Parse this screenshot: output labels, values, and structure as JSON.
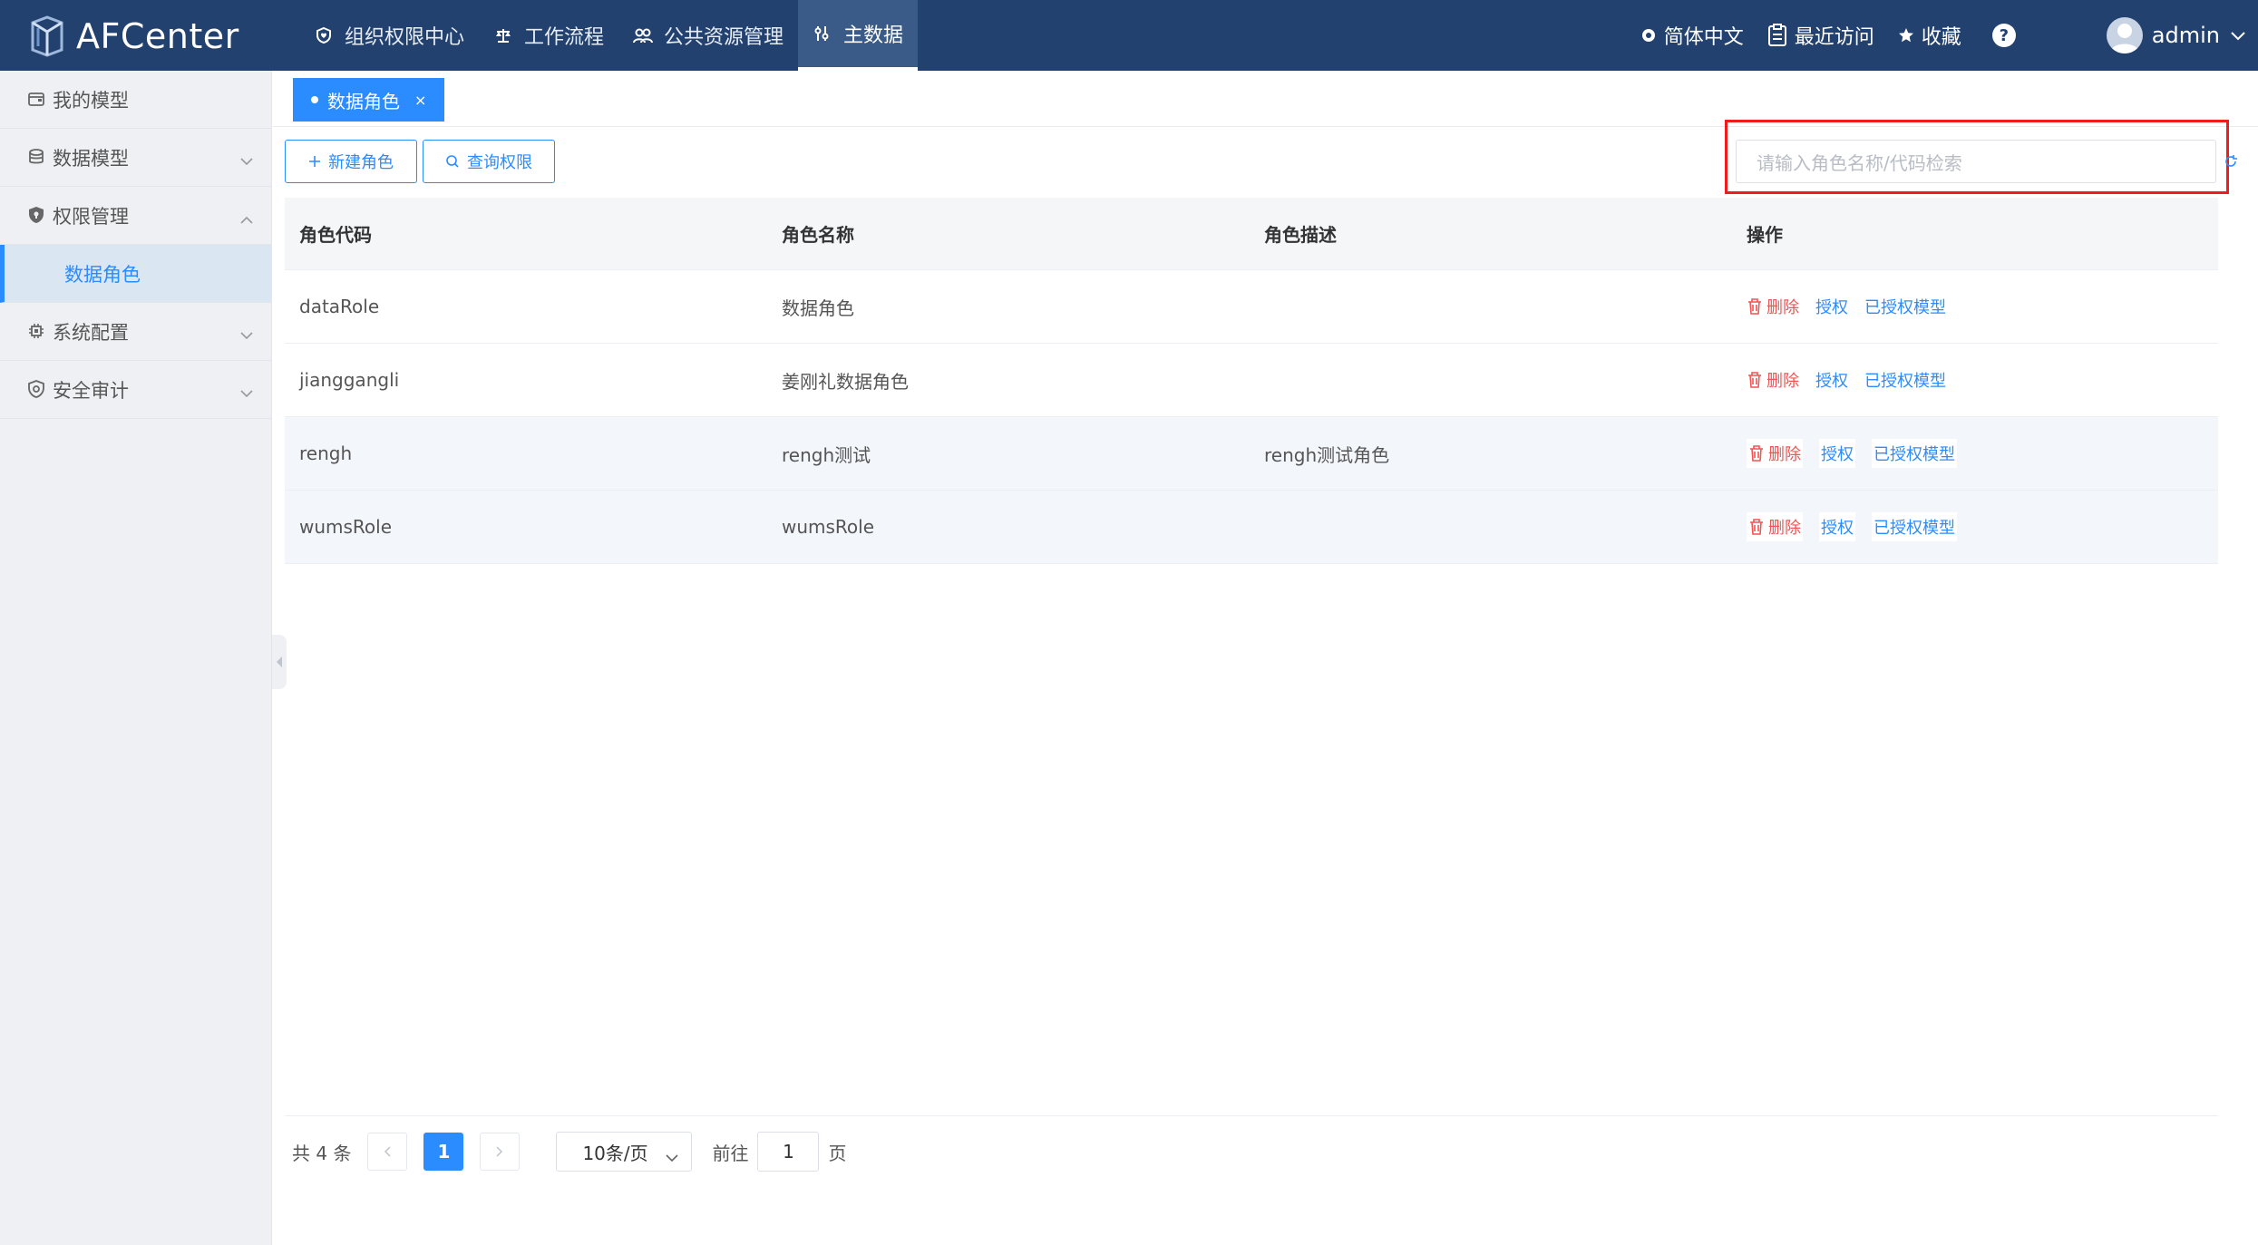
{
  "header": {
    "brand": "AFCenter",
    "nav": [
      {
        "label": "组织权限中心",
        "icon": "shield-heart-icon"
      },
      {
        "label": "工作流程",
        "icon": "balance-icon"
      },
      {
        "label": "公共资源管理",
        "icon": "people-icon"
      },
      {
        "label": "主数据",
        "icon": "tools-icon",
        "active": true
      }
    ],
    "language": "简体中文",
    "recent": "最近访问",
    "favorites": "收藏",
    "help": "?",
    "user": "admin"
  },
  "sidebar": {
    "items": [
      {
        "label": "我的模型"
      },
      {
        "label": "数据模型"
      },
      {
        "label": "权限管理"
      },
      {
        "label": "数据角色"
      },
      {
        "label": "系统配置"
      },
      {
        "label": "安全审计"
      }
    ]
  },
  "tabs": [
    {
      "label": "数据角色",
      "close": "×"
    }
  ],
  "toolbar": {
    "new_role": "新建角色",
    "query_permission": "查询权限",
    "search_placeholder": "请输入角色名称/代码检索"
  },
  "table": {
    "headers": [
      "角色代码",
      "角色名称",
      "角色描述",
      "操作"
    ],
    "rows": [
      {
        "code": "dataRole",
        "name": "数据角色",
        "desc": ""
      },
      {
        "code": "jianggangli",
        "name": "姜刚礼数据角色",
        "desc": ""
      },
      {
        "code": "rengh",
        "name": "rengh测试",
        "desc": "rengh测试角色"
      },
      {
        "code": "wumsRole",
        "name": "wumsRole",
        "desc": ""
      }
    ],
    "actions": {
      "delete": "删除",
      "authorize": "授权",
      "authorized_models": "已授权模型"
    }
  },
  "pagination": {
    "total": "共 4 条",
    "current": "1",
    "page_size": "10条/页",
    "goto_prefix": "前往",
    "goto_value": "1",
    "goto_suffix": "页"
  },
  "colors": {
    "topbar": "#22416f",
    "accent": "#2b8cff",
    "danger": "#f05454",
    "highlight": "#ee1c1c"
  }
}
